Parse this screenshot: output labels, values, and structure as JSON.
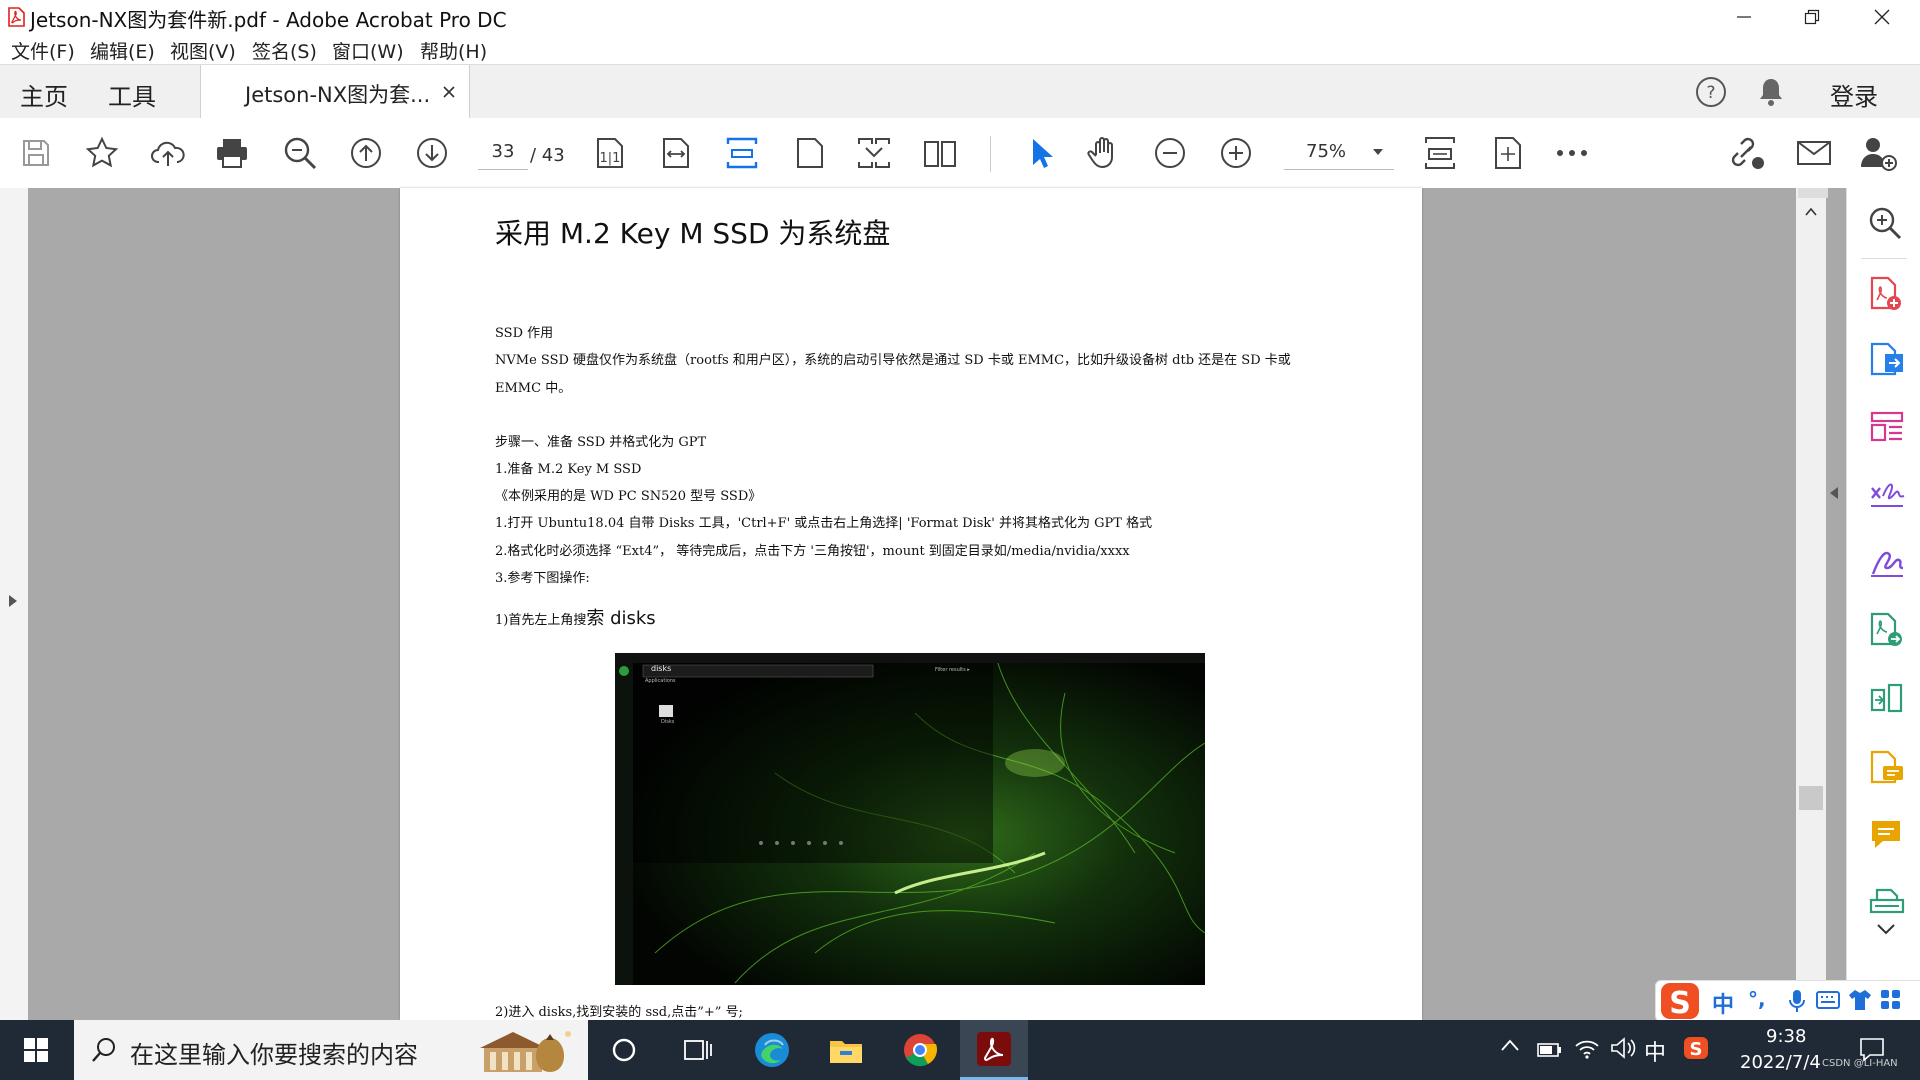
{
  "window": {
    "title": "Jetson-NX图为套件新.pdf - Adobe Acrobat Pro DC",
    "minimize_icon": "minimize-icon",
    "restore_icon": "restore-icon",
    "close_icon": "close-icon"
  },
  "menu": {
    "items": [
      "文件(F)",
      "编辑(E)",
      "视图(V)",
      "签名(S)",
      "窗口(W)",
      "帮助(H)"
    ]
  },
  "tabs": {
    "home": "主页",
    "tools": "工具",
    "document": "Jetson-NX图为套...",
    "login": "登录"
  },
  "toolbar": {
    "current_page": "33",
    "total_pages": "/ 43",
    "zoom": "75%"
  },
  "document": {
    "heading": "采用 M.2 Key M SSD 为系统盘",
    "lines": [
      "SSD 作用",
      "NVMe SSD 硬盘仅作为系统盘（rootfs 和用户区），系统的启动引导依然是通过 SD 卡或 EMMC，比如升级设备树 dtb 还是在 SD 卡或",
      "EMMC 中。",
      "步骤一、准备 SSD 并格式化为 GPT",
      "1.准备 M.2 Key M SSD",
      "《本例采用的是 WD PC SN520 型号 SSD》",
      "1.打开 Ubuntu18.04 自带 Disks 工具，'Ctrl+F' 或点击右上角选择| 'Format Disk' 并将其格式化为 GPT 格式",
      "2.格式化时必须选择 “Ext4”，  等待完成后，点击下方 '三角按钮'，mount 到固定目录如/media/nvidia/xxxx",
      "3.参考下图操作:",
      "2)进入 disks,找到安装的 ssd,点击”+” 号;"
    ],
    "step1_prefix": "1)首先左上角搜",
    "step1_suffix": "索 disks",
    "screenshot": {
      "search_text": "disks",
      "category": "Applications",
      "filter": "Filter results ▸",
      "app_label": "Disks"
    }
  },
  "taskbar": {
    "search_placeholder": "在这里输入你要搜索的内容",
    "ime_lang": "中",
    "time": "9:38",
    "date": "2022/7/4",
    "watermark": "CSDN @LI-HAN"
  },
  "ime": {
    "lang": "中",
    "punct": "°,"
  },
  "colors": {
    "accent_blue": "#1473e6",
    "acrobat_red": "#e0201b",
    "tool_red": "#e34850",
    "tool_blue": "#2680eb",
    "tool_pink": "#d83790",
    "tool_purple": "#7e4bdc",
    "tool_green": "#2d9d78",
    "tool_yellow": "#e8a400",
    "taskbar_bg": "#1f2a36"
  }
}
